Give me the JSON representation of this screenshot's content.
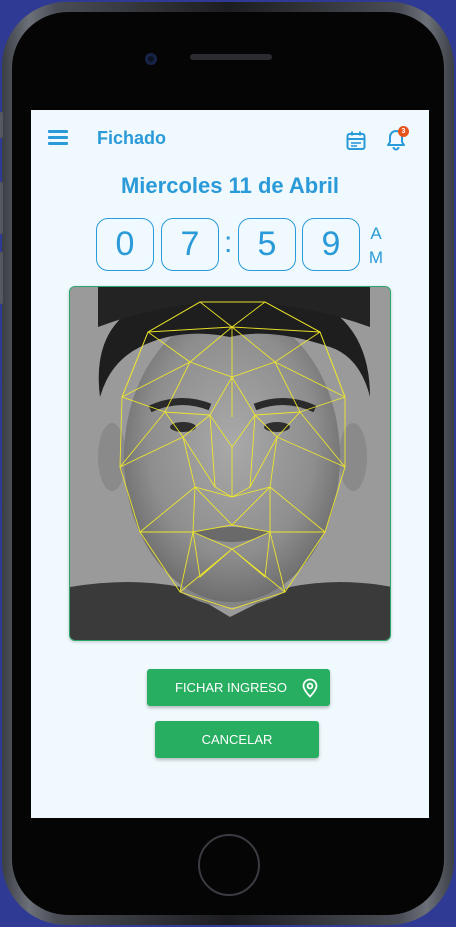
{
  "header": {
    "title": "Fichado",
    "notification_count": "3",
    "icons": {
      "menu": "hamburger-menu-icon",
      "calendar": "calendar-icon",
      "notifications": "bell-icon"
    }
  },
  "date_label": "Miercoles 11 de Abril",
  "clock": {
    "h1": "0",
    "h2": "7",
    "separator": ":",
    "m1": "5",
    "m2": "9",
    "ampm_top": "A",
    "ampm_bottom": "M"
  },
  "buttons": {
    "check_in": "FICHAR INGRESO",
    "cancel": "CANCELAR"
  },
  "colors": {
    "primary": "#2a9ad8",
    "accent_green": "#27ae60",
    "screen_bg": "#f0f9fd",
    "mesh": "#f2ea2a",
    "badge": "#e8541e"
  }
}
